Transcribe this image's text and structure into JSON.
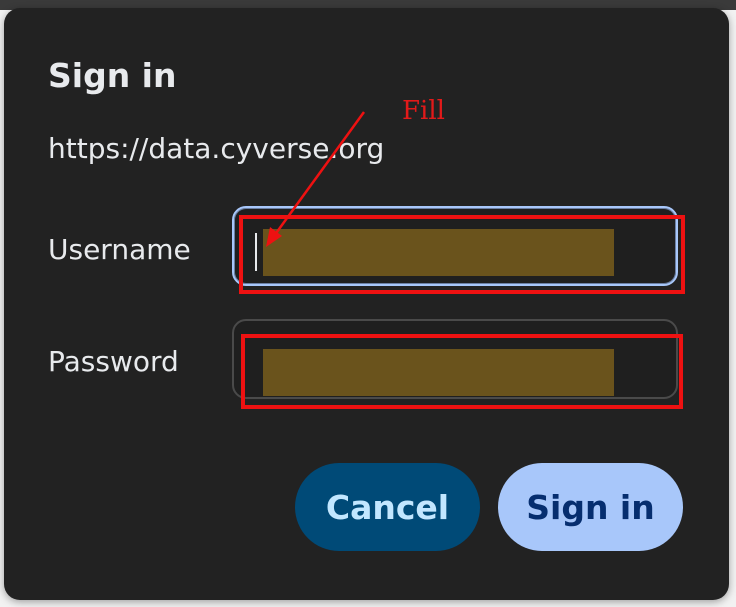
{
  "dialog": {
    "title": "Sign in",
    "origin": "https://data.cyverse.org"
  },
  "fields": {
    "username_label": "Username",
    "username_value": "",
    "password_label": "Password",
    "password_value": ""
  },
  "buttons": {
    "cancel_label": "Cancel",
    "signin_label": "Sign in"
  },
  "annotation": {
    "label": "Fill",
    "color": "#ee1111"
  },
  "colors": {
    "dialog_bg": "#222222",
    "primary_button": "#a8c7fa",
    "secondary_button": "#004a77",
    "redacted_fill": "#6a531c"
  }
}
